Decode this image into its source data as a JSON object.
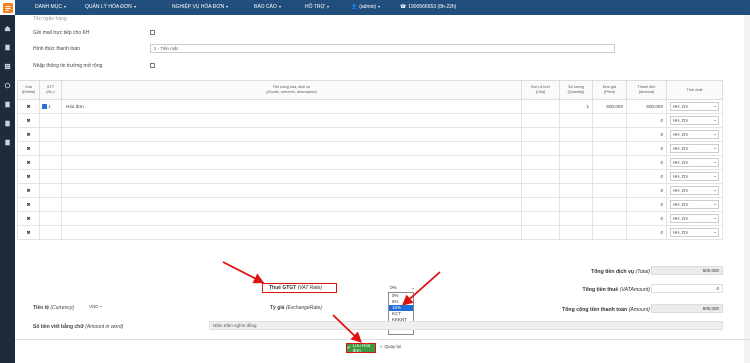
{
  "nav": {
    "items": [
      {
        "label": "DANH MỤC"
      },
      {
        "label": "QUẢN LÝ HÓA ĐƠN"
      },
      {
        "label": "NGHIỆP VỤ HÓA ĐƠN"
      },
      {
        "label": "BÁO CÁO"
      },
      {
        "label": "HỖ TRỢ"
      }
    ],
    "user": "(admin)",
    "phone": "1900566653 (8h-22h)"
  },
  "form": {
    "partial_top": "Tên ngân hàng",
    "send_direct_label": "Gửi mail trực tiếp cho KH",
    "payment_label": "Hình thức thanh toán",
    "payment_value": "1 - Tiền mặt",
    "extended_label": "Nhập thông tin trường mở rộng"
  },
  "table": {
    "headers": [
      {
        "l1": "Xóa",
        "l2": "(Delete)"
      },
      {
        "l1": "STT",
        "l2": "(No.)"
      },
      {
        "l1": "Tên hàng hóa, dịch vụ",
        "l2": "(Goods, services, description)"
      },
      {
        "l1": "Đơn vị tính",
        "l2": "(Unit)"
      },
      {
        "l1": "Số lượng",
        "l2": "(Quantity)"
      },
      {
        "l1": "Đơn giá",
        "l2": "(Price)"
      },
      {
        "l1": "Thành tiền",
        "l2": "(Amount)"
      },
      {
        "l1": "Tính chất",
        "l2": ""
      }
    ],
    "delete_glyph": "✖",
    "rows": [
      {
        "stt": "1",
        "name": "Hóa đơn",
        "qty": "1",
        "price": "500,000",
        "amount": "500,000",
        "type": "HH, DV"
      },
      {
        "amount": "0",
        "type": "HH, DV"
      },
      {
        "amount": "0",
        "type": "HH, DV"
      },
      {
        "amount": "0",
        "type": "HH, DV"
      },
      {
        "amount": "0",
        "type": "HH, DV"
      },
      {
        "amount": "0",
        "type": "HH, DV"
      },
      {
        "amount": "0",
        "type": "HH, DV"
      },
      {
        "amount": "0",
        "type": "HH, DV"
      },
      {
        "amount": "0",
        "type": "HH, DV"
      },
      {
        "amount": "0",
        "type": "HH, DV"
      }
    ]
  },
  "summary": {
    "service_total_label": "Tổng tiền dịch vụ",
    "service_total_en": "(Total)",
    "service_total_value": "500,000",
    "vat_amount_label": "Tổng tiền thuế",
    "vat_amount_en": "(VATAmount)",
    "vat_amount_value": "0",
    "grand_total_label": "Tổng cộng tiền thanh toán",
    "grand_total_en": "(Amount)",
    "grand_total_value": "500,000",
    "vat_rate_label": "Thuế GTGT",
    "vat_rate_en": "(VAT Rate)",
    "vat_selected": "0%",
    "vat_options": [
      "0%",
      "5%",
      "10%",
      "KCT",
      "KKKNT",
      "KHAC"
    ],
    "vat_highlight_index": 2,
    "currency_label": "Tiền tệ",
    "currency_en": "(Currency)",
    "currency_value": "VND",
    "rate_label": "Tỷ giá",
    "rate_en": "(ExchangeRate)",
    "words_label": "Số tiền viết bằng chữ",
    "words_en": "(Amount in word)",
    "words_value": "Năm trăm nghìn đồng"
  },
  "footer": {
    "save_label": "Lưu Hóa đơn",
    "back_label": "Quay lại"
  },
  "colors": {
    "topbar": "#214e7d",
    "sidebar": "#1f2b3a",
    "annotation": "#dd1111",
    "save": "#3d9a41"
  }
}
